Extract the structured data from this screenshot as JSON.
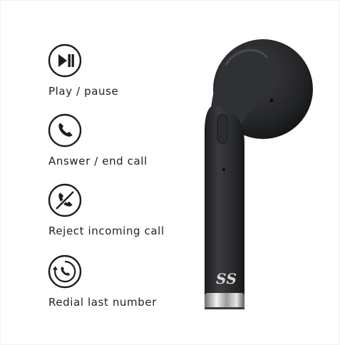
{
  "features": [
    {
      "icon": "play-pause-icon",
      "label": "Play / pause"
    },
    {
      "icon": "phone-icon",
      "label": "Answer / end call"
    },
    {
      "icon": "phone-crossed-icon",
      "label": "Reject incoming call"
    },
    {
      "icon": "phone-redial-icon",
      "label": "Redial last number"
    }
  ],
  "product": {
    "brand_logo": "SBS logo",
    "color": "#2b2c2e"
  }
}
